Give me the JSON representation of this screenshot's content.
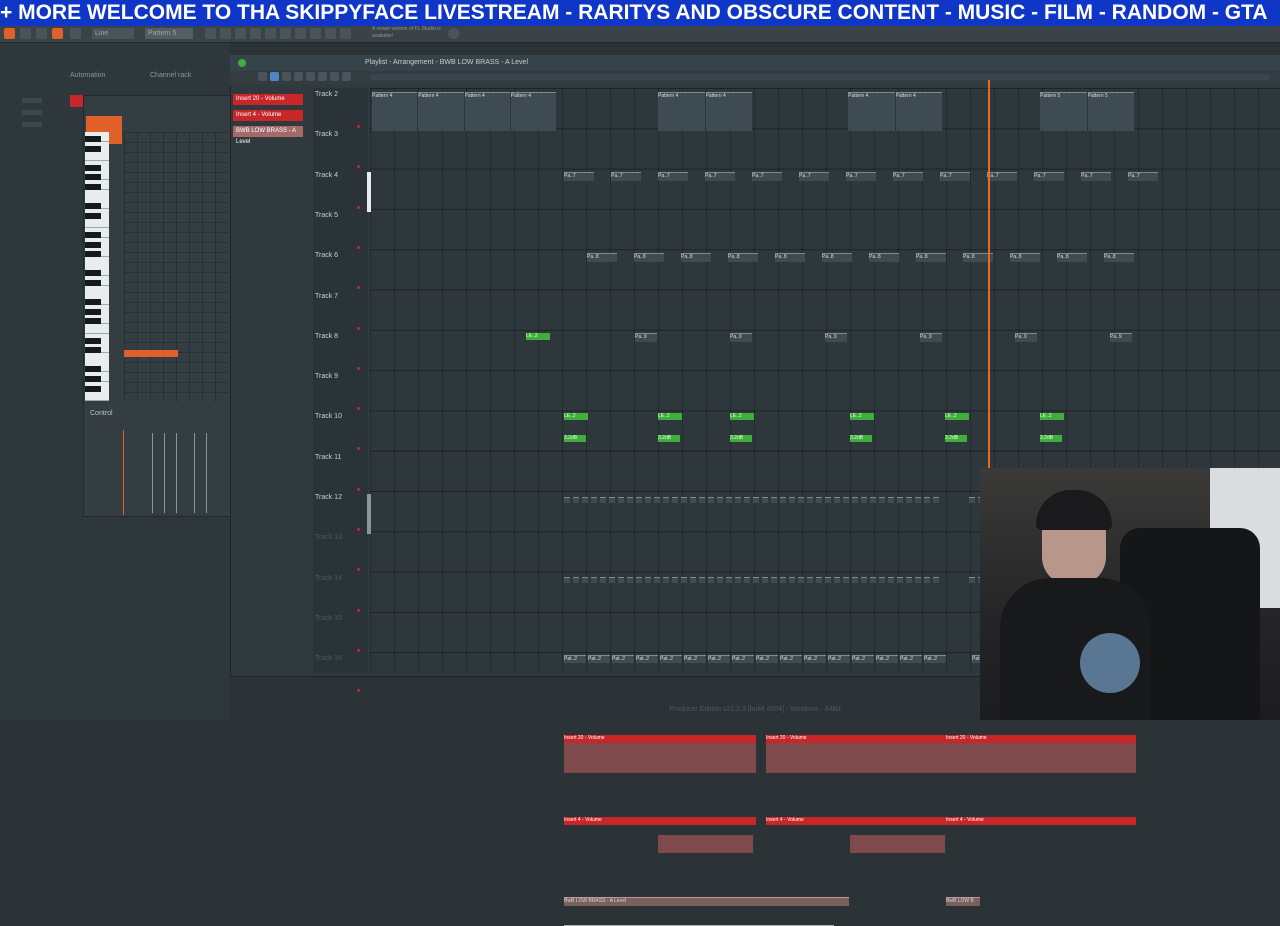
{
  "ticker": {
    "text": "+ MORE  WELCOME TO THA SKIPPYFACE LIVESTREAM  - RARITYS AND OBSCURE CONTENT - MUSIC - FILM - RANDOM - GTA"
  },
  "toolbar": {
    "mode": "Line",
    "pattern_selector": "Pattern 5",
    "notice": "A newer version of FL Studio is available!"
  },
  "browser": {
    "automation_tab": "Automation",
    "channel_rack_tab": "Channel rack"
  },
  "piano_roll": {
    "control_label": "Control"
  },
  "playlist": {
    "title": "Playlist - Arrangement - BWB LOW BRASS - A Level",
    "tracks": [
      "Track 2",
      "Track 3",
      "Track 4",
      "Track 5",
      "Track 6",
      "Track 7",
      "Track 8",
      "Track 9",
      "Track 10",
      "Track 11",
      "Track 12",
      "Track 13",
      "Track 14",
      "Track 15",
      "Track 16"
    ]
  },
  "insert_list": [
    "Insert 20 - Volume",
    "Insert 4 - Volume",
    "BWB LOW BRASS - A Level"
  ],
  "clips": {
    "pattern4": "Pattern 4",
    "pattern5": "Pattern 5",
    "pat7": "Pa..7",
    "pat8": "Pa..8",
    "pat9": "Pa..9",
    "pat2": "Pat..2",
    "greenA": "LE..2",
    "greenB": "3.2dB",
    "insert20": "Insert 20 - Volume",
    "insert4": "Insert 4 - Volume",
    "brass": "BwB LOW BRASS - A Level",
    "brass_short": "BwB LOW B"
  },
  "footer": {
    "text": "Producer Edition v21.2.3 [build 4004] - Windows - 64Bit"
  },
  "colors": {
    "ticker_bg": "#1036c8",
    "playhead": "#e86a1c",
    "automation_red": "#c9262a",
    "green_clip": "#3fae3a"
  }
}
